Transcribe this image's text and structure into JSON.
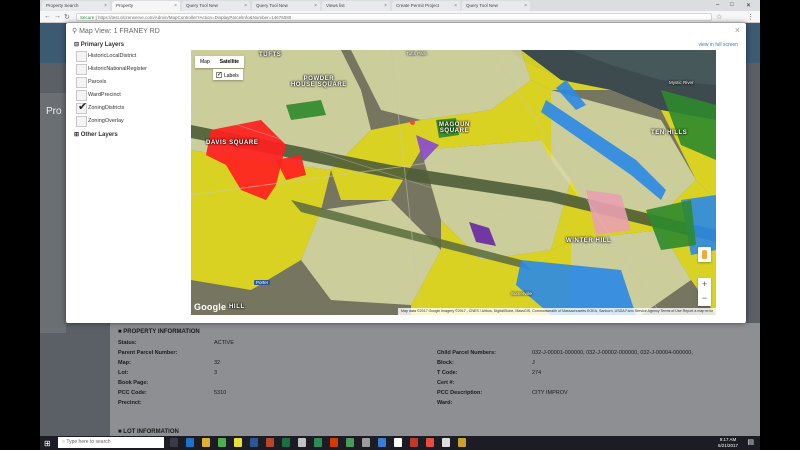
{
  "browser": {
    "tabs": [
      {
        "label": "Property Search"
      },
      {
        "label": "Property"
      },
      {
        "label": "Query Tool New"
      },
      {
        "label": "Query Tool New"
      },
      {
        "label": "Views list"
      },
      {
        "label": "Create Permit Project"
      },
      {
        "label": "Query Tool New"
      }
    ],
    "url_secure": "Secure",
    "url": "https://test.citizenserve.com/Admin/MapController?Action=DisplayParcelInfo&Number=14676080",
    "minimize": "–",
    "maximize": "□",
    "close": "✕",
    "back": "←",
    "forward": "→",
    "reload": "↻",
    "menu": "⋮",
    "star": "☆"
  },
  "page": {
    "side_label": "Pro",
    "info_heading": "PROPERTY INFORMATION",
    "lot_heading": "LOT INFORMATION",
    "rows_left": [
      {
        "label": "Status:",
        "value": "ACTIVE"
      },
      {
        "label": "Parent Parcel Number:",
        "value": ""
      },
      {
        "label": "Map:",
        "value": "32"
      },
      {
        "label": "Lot:",
        "value": "3"
      },
      {
        "label": "Book Page:",
        "value": ""
      },
      {
        "label": "PCC Code:",
        "value": "5310"
      },
      {
        "label": "Precinct:",
        "value": ""
      }
    ],
    "rows_right": [
      {
        "label": "Child Parcel Numbers:",
        "value": "032-J-00001-000000, 032-J-00002-000000, 032-J-00004-000000,"
      },
      {
        "label": "Block:",
        "value": "J"
      },
      {
        "label": "T Code:",
        "value": "274"
      },
      {
        "label": "Cert #:",
        "value": ""
      },
      {
        "label": "PCC Description:",
        "value": "CITY IMPROV"
      },
      {
        "label": "Ward:",
        "value": ""
      }
    ]
  },
  "modal": {
    "title": "Map View: 1 FRANEY RD",
    "close": "×",
    "fullscreen_link": "view in full screen",
    "primary_group": "Primary Layers",
    "other_group": "Other Layers",
    "layers": [
      {
        "label": "HistoricLocalDistrict",
        "checked": false
      },
      {
        "label": "HistoricNationalRegister",
        "checked": false
      },
      {
        "label": "Parcels",
        "checked": false
      },
      {
        "label": "WardPrecinct",
        "checked": false
      },
      {
        "label": "ZoningDistricts",
        "checked": true
      },
      {
        "label": "ZoningOverlay",
        "checked": false
      }
    ]
  },
  "map": {
    "type_map": "Map",
    "type_satellite": "Satellite",
    "labels": "Labels",
    "places": {
      "tufts": "TUFTS",
      "powder_house": "POWDER\nHOUSE SQUARE",
      "magoun": "MAGOUN\nSQUARE",
      "davis": "DAVIS SQUARE",
      "ten_hills": "TEN HILLS",
      "winter_hill": "WINTER HILL",
      "mystic_river": "Mystic River",
      "tufts_park": "Tufts Park",
      "porter": "Porter",
      "somerville": "Somerville",
      "hill": "HILL"
    },
    "google": "Google",
    "attribution": "Map data ©2017 Google Imagery ©2017 , CNES / Airbus, DigitalGlobe, MassGIS, Commonwealth of Massachusetts EOEA, Sanborn, USDA Farm Service Agency   Terms of Use   Report a map error",
    "zoom_in": "+",
    "zoom_out": "−",
    "colors": {
      "residential": "#d7d9a4",
      "business": "#e7df1b",
      "central": "#ff1f1f",
      "industrial": "#2a8ae6",
      "green": "#2d8a2d",
      "purple": "#8d4fc9",
      "pink": "#e9a0b0"
    }
  },
  "taskbar": {
    "start": "⊞",
    "search": "Type here to search",
    "time": "9:17 AM",
    "date": "6/21/2017",
    "notification": "▤"
  }
}
